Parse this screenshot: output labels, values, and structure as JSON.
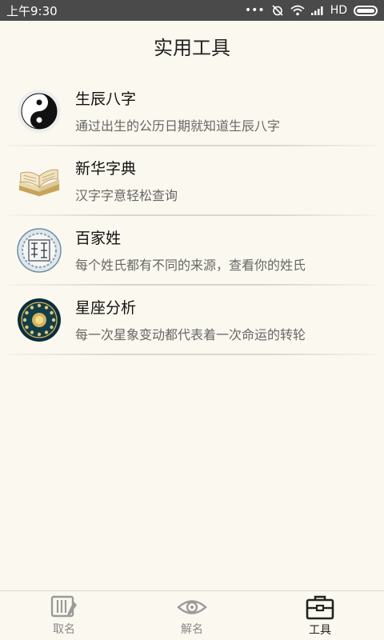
{
  "status": {
    "time": "上午9:30",
    "network": "HD"
  },
  "header": {
    "title": "实用工具"
  },
  "tools": [
    {
      "name": "生辰八字",
      "desc": "通过出生的公历日期就知道生辰八字",
      "icon": "yin-yang-icon"
    },
    {
      "name": "新华字典",
      "desc": "汉字字意轻松查询",
      "icon": "book-icon"
    },
    {
      "name": "百家姓",
      "desc": "每个姓氏都有不同的来源，查看你的姓氏",
      "icon": "surname-seal-icon"
    },
    {
      "name": "星座分析",
      "desc": "每一次星象变动都代表着一次命运的转轮",
      "icon": "zodiac-wheel-icon"
    }
  ],
  "tabs": [
    {
      "label": "取名",
      "icon": "naming-icon",
      "active": false
    },
    {
      "label": "解名",
      "icon": "eye-icon",
      "active": false
    },
    {
      "label": "工具",
      "icon": "toolbox-icon",
      "active": true
    }
  ]
}
